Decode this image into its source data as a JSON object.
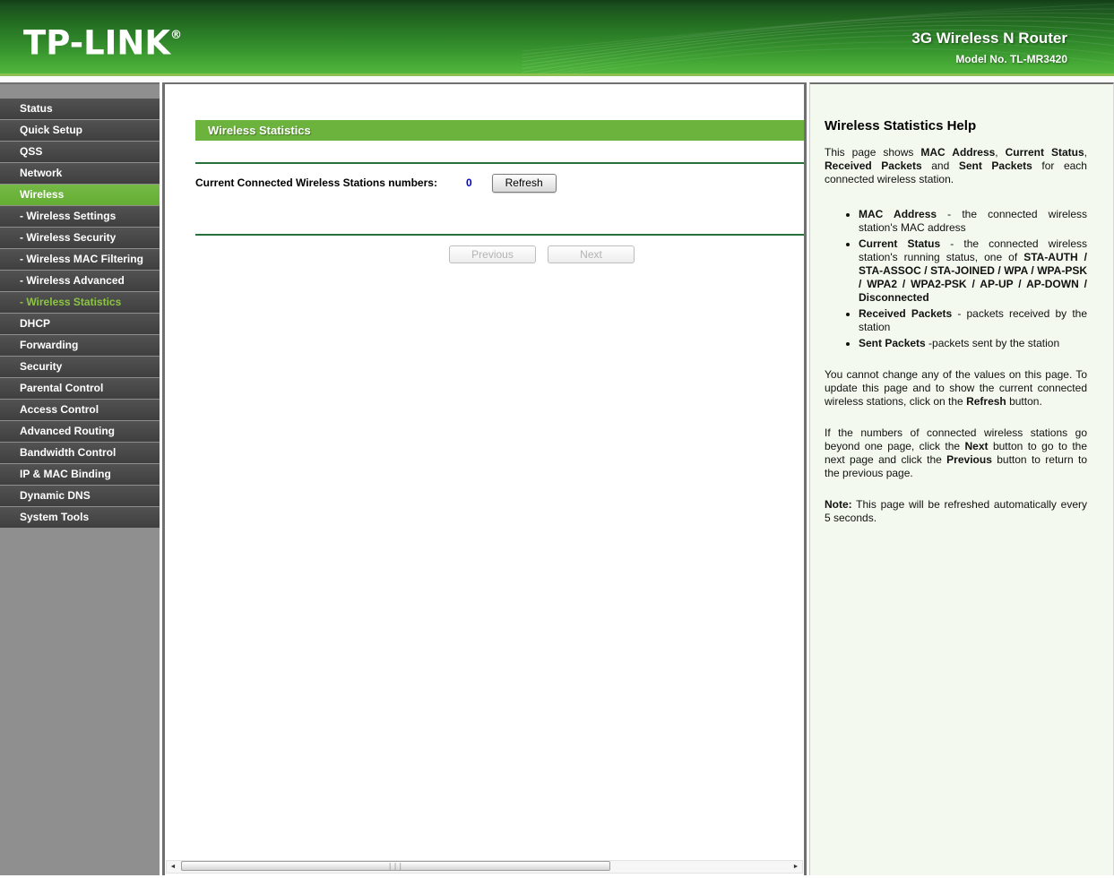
{
  "header": {
    "logo": "TP-LINK",
    "logo_reg": "®",
    "product": "3G Wireless N Router",
    "model": "Model No. TL-MR3420"
  },
  "sidebar": {
    "items": [
      {
        "label": "Status"
      },
      {
        "label": "Quick Setup"
      },
      {
        "label": "QSS"
      },
      {
        "label": "Network"
      },
      {
        "label": "Wireless",
        "state": "active"
      },
      {
        "label": "- Wireless Settings"
      },
      {
        "label": "- Wireless Security"
      },
      {
        "label": "- Wireless MAC Filtering"
      },
      {
        "label": "- Wireless Advanced"
      },
      {
        "label": "- Wireless Statistics",
        "state": "active-sub"
      },
      {
        "label": "DHCP"
      },
      {
        "label": "Forwarding"
      },
      {
        "label": "Security"
      },
      {
        "label": "Parental Control"
      },
      {
        "label": "Access Control"
      },
      {
        "label": "Advanced Routing"
      },
      {
        "label": "Bandwidth Control"
      },
      {
        "label": "IP & MAC Binding"
      },
      {
        "label": "Dynamic DNS"
      },
      {
        "label": "System Tools"
      }
    ]
  },
  "main": {
    "title": "Wireless Statistics",
    "stations_label": "Current Connected Wireless Stations numbers:",
    "stations_count": "0",
    "refresh_label": "Refresh",
    "previous_label": "Previous",
    "next_label": "Next",
    "scrollbar": {
      "left_arrow_icon": "◄",
      "right_arrow_icon": "►",
      "grip_icon": "|||"
    }
  },
  "help": {
    "title": "Wireless Statistics Help",
    "intro": [
      {
        "t": "This page shows ",
        "b": false
      },
      {
        "t": "MAC Address",
        "b": true
      },
      {
        "t": ", ",
        "b": false
      },
      {
        "t": "Current Status",
        "b": true
      },
      {
        "t": ", ",
        "b": false
      },
      {
        "t": "Received Packets",
        "b": true
      },
      {
        "t": " and ",
        "b": false
      },
      {
        "t": "Sent Packets",
        "b": true
      },
      {
        "t": " for each connected wireless station.",
        "b": false
      }
    ],
    "bullets": [
      [
        {
          "t": "MAC Address",
          "b": true
        },
        {
          "t": " - the connected wireless station's MAC address",
          "b": false
        }
      ],
      [
        {
          "t": "Current Status",
          "b": true
        },
        {
          "t": " - the connected wireless station's running status, one of ",
          "b": false
        },
        {
          "t": "STA-AUTH / STA-ASSOC / STA-JOINED / WPA / WPA-PSK / WPA2 / WPA2-PSK / AP-UP / AP-DOWN / Disconnected",
          "b": true
        }
      ],
      [
        {
          "t": "Received Packets",
          "b": true
        },
        {
          "t": " - packets received by the station",
          "b": false
        }
      ],
      [
        {
          "t": "Sent Packets",
          "b": true
        },
        {
          "t": " -packets sent by the station",
          "b": false
        }
      ]
    ],
    "paragraphs": [
      [
        {
          "t": "You cannot change any of the values on this page. To update this page and to show the current connected wireless stations, click on the ",
          "b": false
        },
        {
          "t": "Refresh",
          "b": true
        },
        {
          "t": " button.",
          "b": false
        }
      ],
      [
        {
          "t": "If the numbers of connected wireless stations go beyond one page, click the ",
          "b": false
        },
        {
          "t": "Next",
          "b": true
        },
        {
          "t": " button to go to the next page and click the ",
          "b": false
        },
        {
          "t": "Previous",
          "b": true
        },
        {
          "t": " button to return to the previous page.",
          "b": false
        }
      ],
      [
        {
          "t": "Note:",
          "b": true
        },
        {
          "t": " This page will be refreshed automatically every 5 seconds.",
          "b": false
        }
      ]
    ]
  },
  "colors": {
    "accent_green": "#6cb33d",
    "divider_green": "#27713d",
    "count_blue": "#0000cc",
    "help_bg": "#f3f9ee",
    "sidebar_bg": "#8f8f8f",
    "active_sub_text": "#8bc541"
  }
}
